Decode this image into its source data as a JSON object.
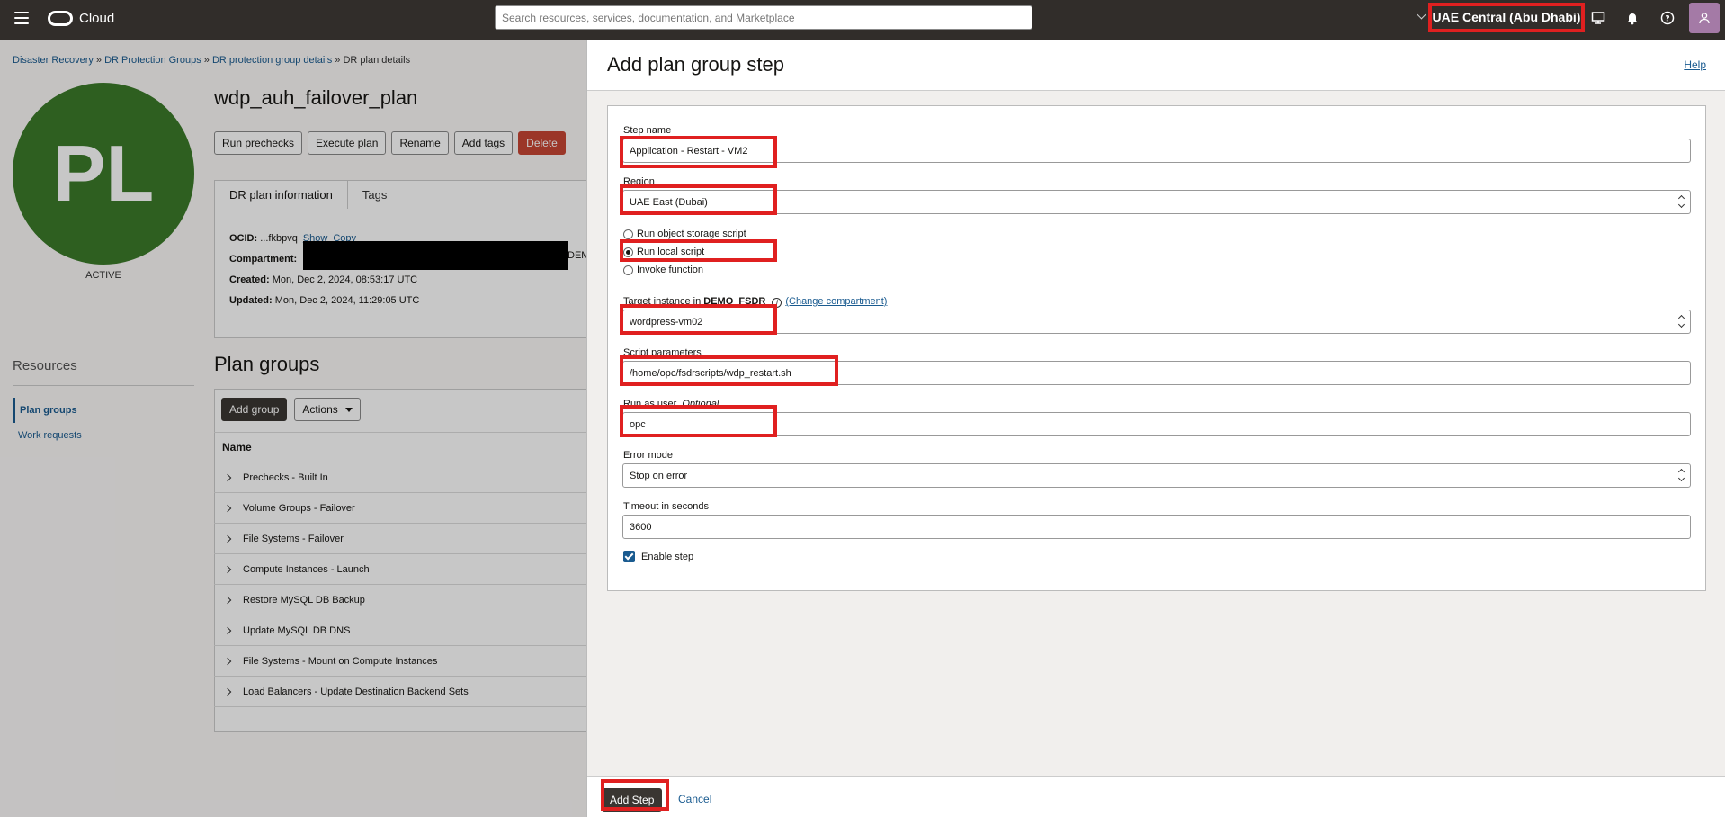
{
  "topbar": {
    "brand": "Cloud",
    "search_placeholder": "Search resources, services, documentation, and Marketplace",
    "region": "UAE Central (Abu Dhabi)"
  },
  "breadcrumb": [
    "Disaster Recovery",
    "DR Protection Groups",
    "DR protection group details",
    "DR plan details"
  ],
  "plan": {
    "initials": "PL",
    "status": "ACTIVE",
    "title": "wdp_auh_failover_plan",
    "buttons": [
      "Run prechecks",
      "Execute plan",
      "Rename",
      "Add tags",
      "Delete"
    ]
  },
  "info_tabs": [
    "DR plan information",
    "Tags"
  ],
  "info": {
    "ocid_label": "OCID:",
    "ocid_value": "...fkbpvq",
    "show": "Show",
    "copy": "Copy",
    "compartment_label": "Compartment:",
    "compartment_tail": "DEM",
    "created_label": "Created:",
    "created_value": "Mon, Dec 2, 2024, 08:53:17 UTC",
    "updated_label": "Updated:",
    "updated_value": "Mon, Dec 2, 2024, 11:29:05 UTC"
  },
  "resources": {
    "title": "Resources",
    "items": [
      "Plan groups",
      "Work requests"
    ]
  },
  "plan_groups": {
    "title": "Plan groups",
    "add_group": "Add group",
    "actions": "Actions",
    "column_name": "Name",
    "rows": [
      "Prechecks - Built In",
      "Volume Groups - Failover",
      "File Systems - Failover",
      "Compute Instances - Launch",
      "Restore MySQL DB Backup",
      "Update MySQL DB DNS",
      "File Systems - Mount on Compute Instances",
      "Load Balancers - Update Destination Backend Sets"
    ]
  },
  "drawer": {
    "title": "Add plan group step",
    "help": "Help",
    "step_name_label": "Step name",
    "step_name_value": "Application - Restart - VM2",
    "region_label": "Region",
    "region_value": "UAE East (Dubai)",
    "radio_options": [
      "Run object storage script",
      "Run local script",
      "Invoke function"
    ],
    "target_label_prefix": "Target instance in",
    "target_compartment": "DEMO_FSDR",
    "change_compartment": "(Change compartment)",
    "target_value": "wordpress-vm02",
    "script_label": "Script parameters",
    "script_value": "/home/opc/fsdrscripts/wdp_restart.sh",
    "run_as_label": "Run as user",
    "optional": "Optional",
    "run_as_value": "opc",
    "error_mode_label": "Error mode",
    "error_mode_value": "Stop on error",
    "timeout_label": "Timeout in seconds",
    "timeout_value": "3600",
    "enable_step": "Enable step",
    "add_step": "Add Step",
    "cancel": "Cancel"
  }
}
